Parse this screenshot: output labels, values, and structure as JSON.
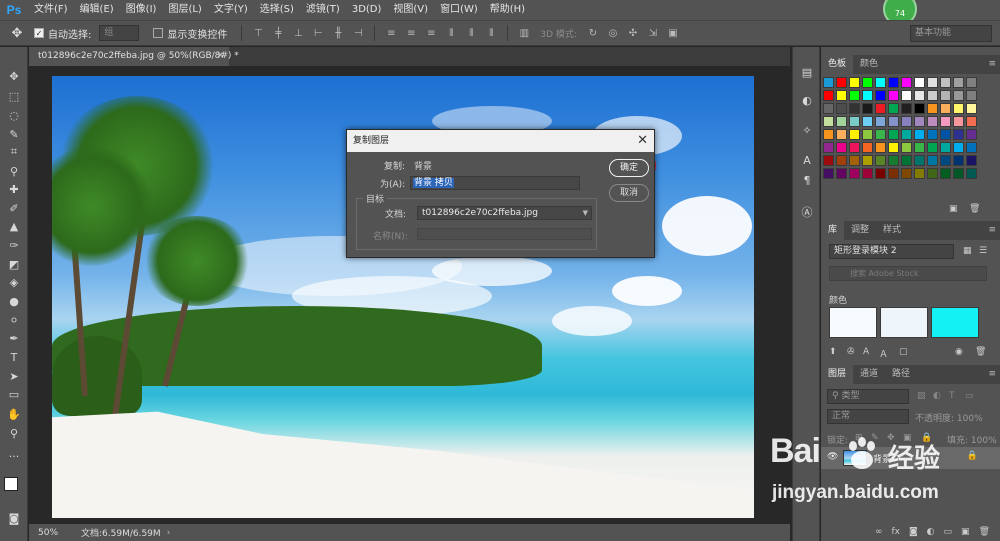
{
  "app": {
    "logo": "Ps",
    "user_badge": "74"
  },
  "menubar": {
    "items": [
      "文件(F)",
      "编辑(E)",
      "图像(I)",
      "图层(L)",
      "文字(Y)",
      "选择(S)",
      "滤镜(T)",
      "3D(D)",
      "视图(V)",
      "窗口(W)",
      "帮助(H)"
    ]
  },
  "options": {
    "auto_select_label": "自动选择:",
    "auto_select_value": "组",
    "show_transform_label": "显示变换控件",
    "mode_3d_label": "3D 模式:",
    "workspace": "基本功能"
  },
  "document": {
    "tab_title": "t012896c2e70c2ffeba.jpg @ 50%(RGB/8#) *",
    "zoom": "50%",
    "doc_size": "文档:6.59M/6.59M"
  },
  "dialog": {
    "title": "复制图层",
    "duplicate_label": "复制:",
    "duplicate_value": "背景",
    "as_label": "为(A):",
    "as_value": "背景 拷贝",
    "destination_label": "目标",
    "document_label": "文档:",
    "document_value": "t012896c2e70c2ffeba.jpg",
    "name_label": "名称(N):",
    "ok_label": "确定",
    "cancel_label": "取消"
  },
  "panels": {
    "swatch_tabs": [
      "色板",
      "颜色"
    ],
    "library_tabs": [
      "库",
      "调整",
      "样式"
    ],
    "library_select": "矩形登录模块 2",
    "library_search_placeholder": "搜索 Adobe Stock",
    "colors_heading": "颜色",
    "library_colors": [
      "#f7fbfd",
      "#eef6fb",
      "#13f1f4"
    ],
    "layer_tabs": [
      "图层",
      "通道",
      "路径"
    ],
    "layer_kind": "类型",
    "blend_mode": "正常",
    "opacity_label": "不透明度: 100%",
    "lock_label": "锁定:",
    "fill_label": "填充: 100%",
    "layer_name": "背景"
  },
  "watermark": {
    "brand": "Bai",
    "brand_cn": "经验",
    "url": "jingyan.baidu.com"
  },
  "colors": {
    "chrome": "#535353",
    "canvas_bg": "#282828",
    "annotation": "#e8232a",
    "selection": "#2d66b8"
  },
  "icons": [
    "move-icon",
    "marquee-icon",
    "lasso-icon",
    "quick-select-icon",
    "crop-icon",
    "eyedropper-icon",
    "healing-icon",
    "brush-icon",
    "stamp-icon",
    "history-brush-icon",
    "eraser-icon",
    "gradient-icon",
    "blur-icon",
    "dodge-icon",
    "pen-icon",
    "type-icon",
    "path-select-icon",
    "shape-icon",
    "hand-icon",
    "zoom-icon",
    "more-icon"
  ]
}
